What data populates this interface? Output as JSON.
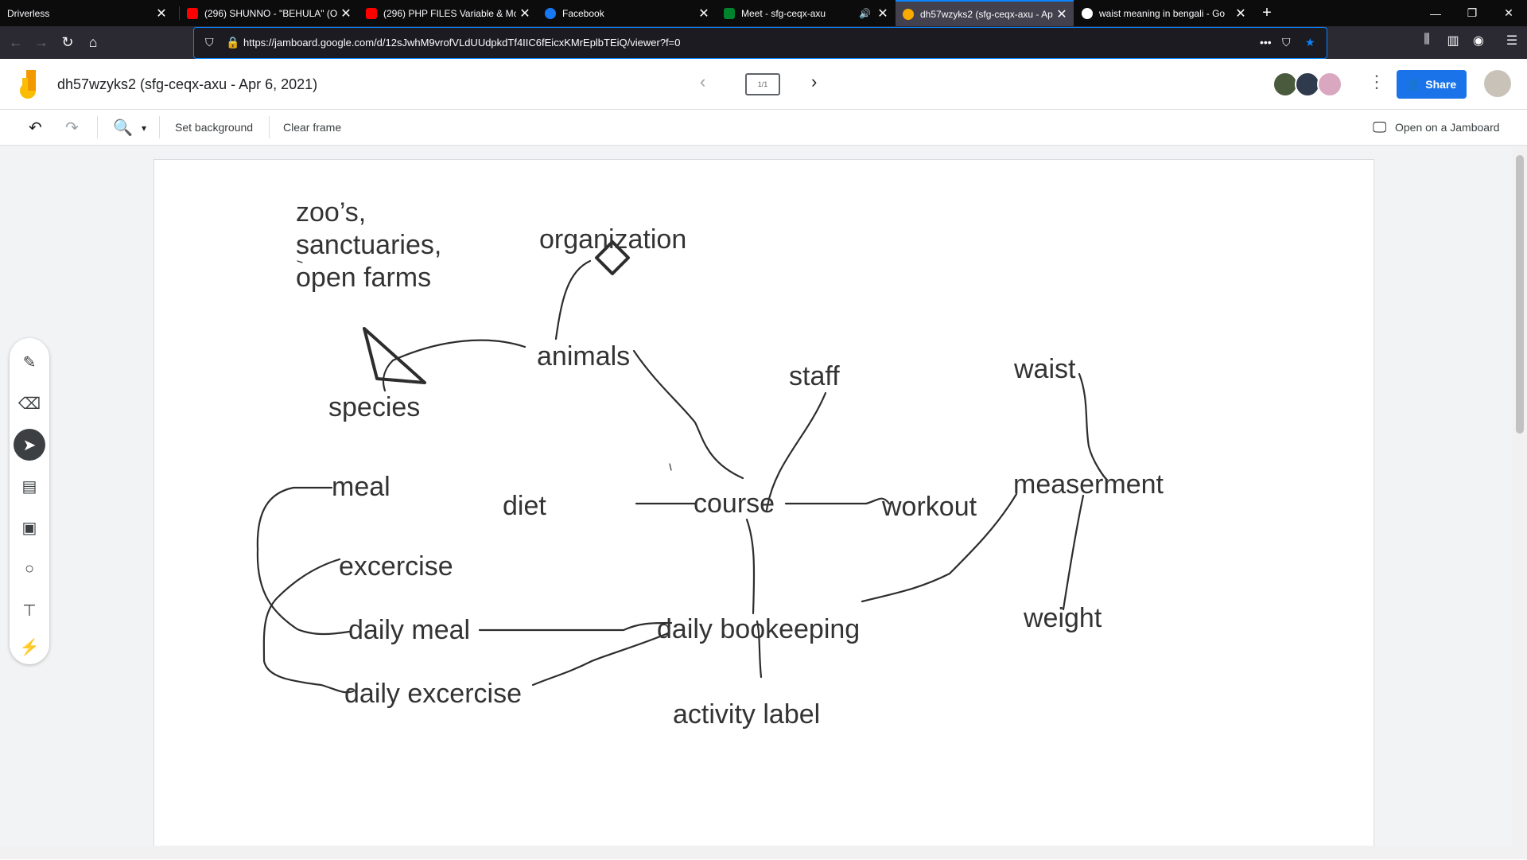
{
  "browser": {
    "tabs": [
      {
        "title": "Driverless",
        "icon": "none"
      },
      {
        "title": "(296) SHUNNO - \"BEHULA\" (O",
        "icon": "youtube-icon"
      },
      {
        "title": "(296) PHP FILES Variable & Mo",
        "icon": "youtube-icon"
      },
      {
        "title": "Facebook",
        "icon": "facebook-icon"
      },
      {
        "title": "Meet - sfg-ceqx-axu",
        "icon": "meet-icon"
      },
      {
        "title": "dh57wzyks2 (sfg-ceqx-axu - Ap",
        "icon": "jamboard-icon"
      },
      {
        "title": "waist meaning in bengali - Go",
        "icon": "google-icon"
      }
    ],
    "url": "https://jamboard.google.com/d/12sJwhM9vrofVLdUUdpkdTf4IIC6fEicxKMrEplbTEiQ/viewer?f=0",
    "colors": {
      "tabbar": "#0c0c0d",
      "navbar": "#2b2a33",
      "accent": "#0a84ff"
    }
  },
  "jamboard": {
    "title": "dh57wzyks2 (sfg-ceqx-axu - Apr 6, 2021)",
    "frame_indicator": "1/1",
    "share_label": "Share",
    "toolbar": {
      "set_background": "Set background",
      "clear_frame": "Clear frame",
      "open_on_jamboard": "Open on a Jamboard"
    },
    "colors": {
      "share": "#1a73e8"
    }
  },
  "whiteboard": {
    "labels": [
      {
        "id": "zoos-1",
        "text": "zoo’s,"
      },
      {
        "id": "zoos-2",
        "text": "sanctuaries,"
      },
      {
        "id": "zoos-3",
        "text": "open farms"
      },
      {
        "id": "organization",
        "text": "organization"
      },
      {
        "id": "animals",
        "text": "animals"
      },
      {
        "id": "species",
        "text": "species"
      },
      {
        "id": "staff",
        "text": "staff"
      },
      {
        "id": "waist",
        "text": "waist"
      },
      {
        "id": "meal",
        "text": "meal"
      },
      {
        "id": "diet",
        "text": "diet"
      },
      {
        "id": "course",
        "text": "course"
      },
      {
        "id": "workout",
        "text": "workout"
      },
      {
        "id": "measerment",
        "text": "measerment"
      },
      {
        "id": "excercise",
        "text": "excercise"
      },
      {
        "id": "daily-meal",
        "text": "daily meal"
      },
      {
        "id": "daily-bookkeeping",
        "text": "daily bookeeping"
      },
      {
        "id": "weight",
        "text": "weight"
      },
      {
        "id": "daily-excercise",
        "text": "daily excercise"
      },
      {
        "id": "activity-label",
        "text": "activity label"
      }
    ]
  }
}
